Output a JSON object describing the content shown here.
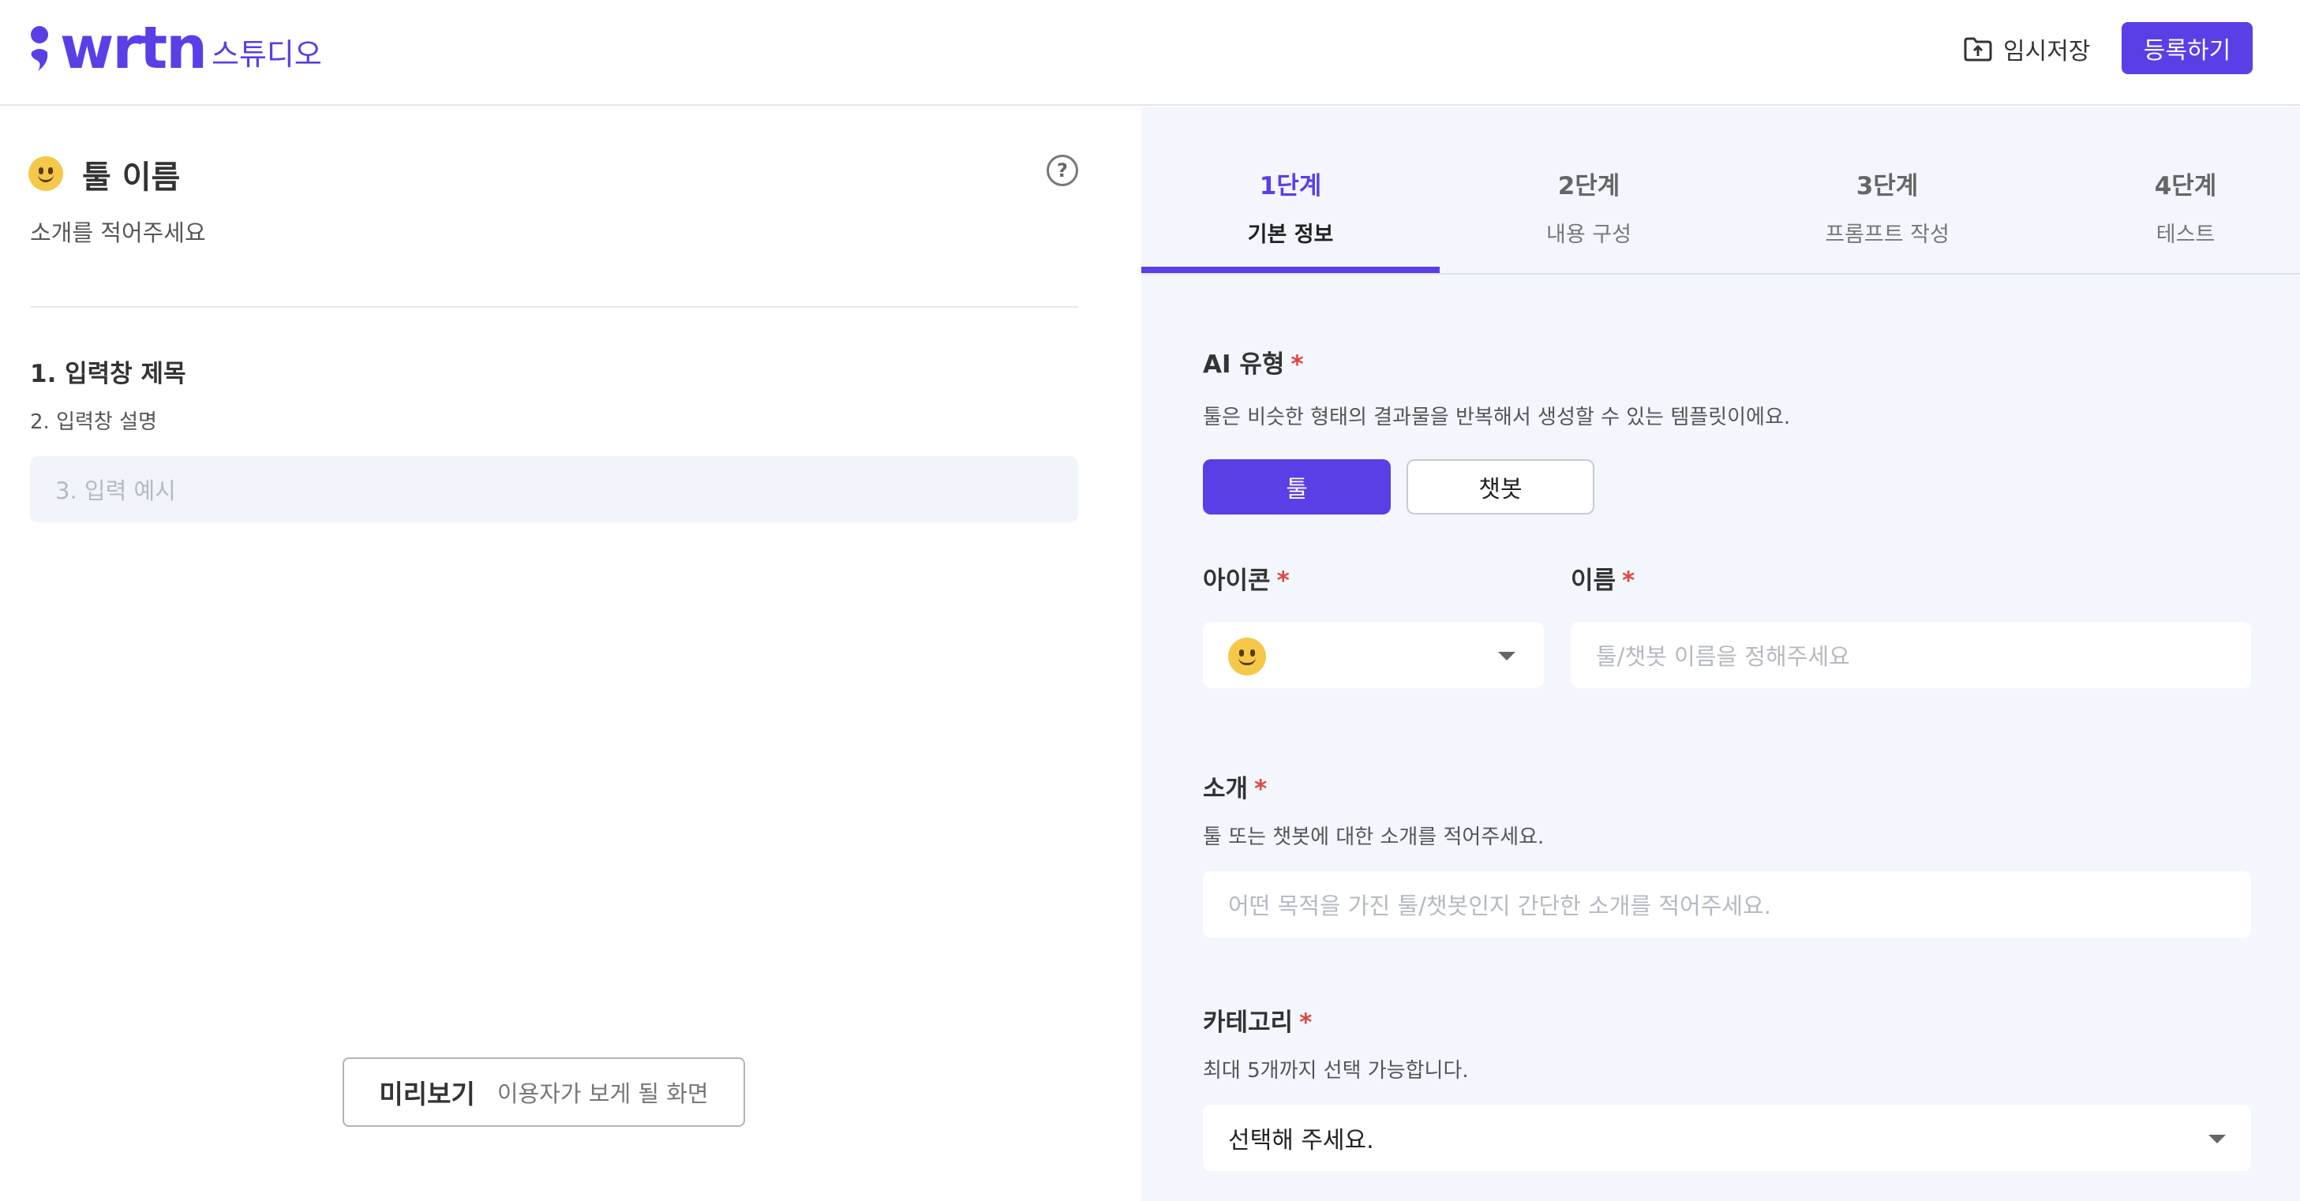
{
  "header": {
    "logo_text": "wrtn",
    "studio_label": "스튜디오",
    "save_label": "임시저장",
    "register_label": "등록하기"
  },
  "preview": {
    "tool_name": "툴 이름",
    "tool_intro": "소개를 적어주세요",
    "field_title": "1. 입력창 제목",
    "field_desc": "2. 입력창 설명",
    "example_placeholder": "3. 입력 예시",
    "preview_button_label": "미리보기",
    "preview_button_sub": "이용자가 보게 될 화면"
  },
  "steps": [
    {
      "num": "1단계",
      "name": "기본 정보",
      "active": true
    },
    {
      "num": "2단계",
      "name": "내용 구성",
      "active": false
    },
    {
      "num": "3단계",
      "name": "프롬프트 작성",
      "active": false
    },
    {
      "num": "4단계",
      "name": "테스트",
      "active": false
    }
  ],
  "form": {
    "required_mark": "*",
    "ai_type": {
      "label": "AI 유형",
      "help": "툴은 비슷한 형태의 결과물을 반복해서 생성할 수 있는 템플릿이에요.",
      "options": [
        "툴",
        "챗봇"
      ],
      "selected": "툴"
    },
    "icon": {
      "label": "아이콘",
      "selected_icon": "smiling-face-emoji"
    },
    "name": {
      "label": "이름",
      "placeholder": "툴/챗봇 이름을 정해주세요"
    },
    "intro": {
      "label": "소개",
      "help": "툴 또는 챗봇에 대한 소개를 적어주세요.",
      "placeholder": "어떤 목적을 가진 툴/챗봇인지 간단한 소개를 적어주세요."
    },
    "category": {
      "label": "카테고리",
      "help": "최대 5개까지 선택 가능합니다.",
      "selected_text": "선택해 주세요."
    }
  },
  "colors": {
    "brand": "#5a3ee6",
    "required": "#e0463e",
    "panel_bg": "#f3f6fd"
  }
}
